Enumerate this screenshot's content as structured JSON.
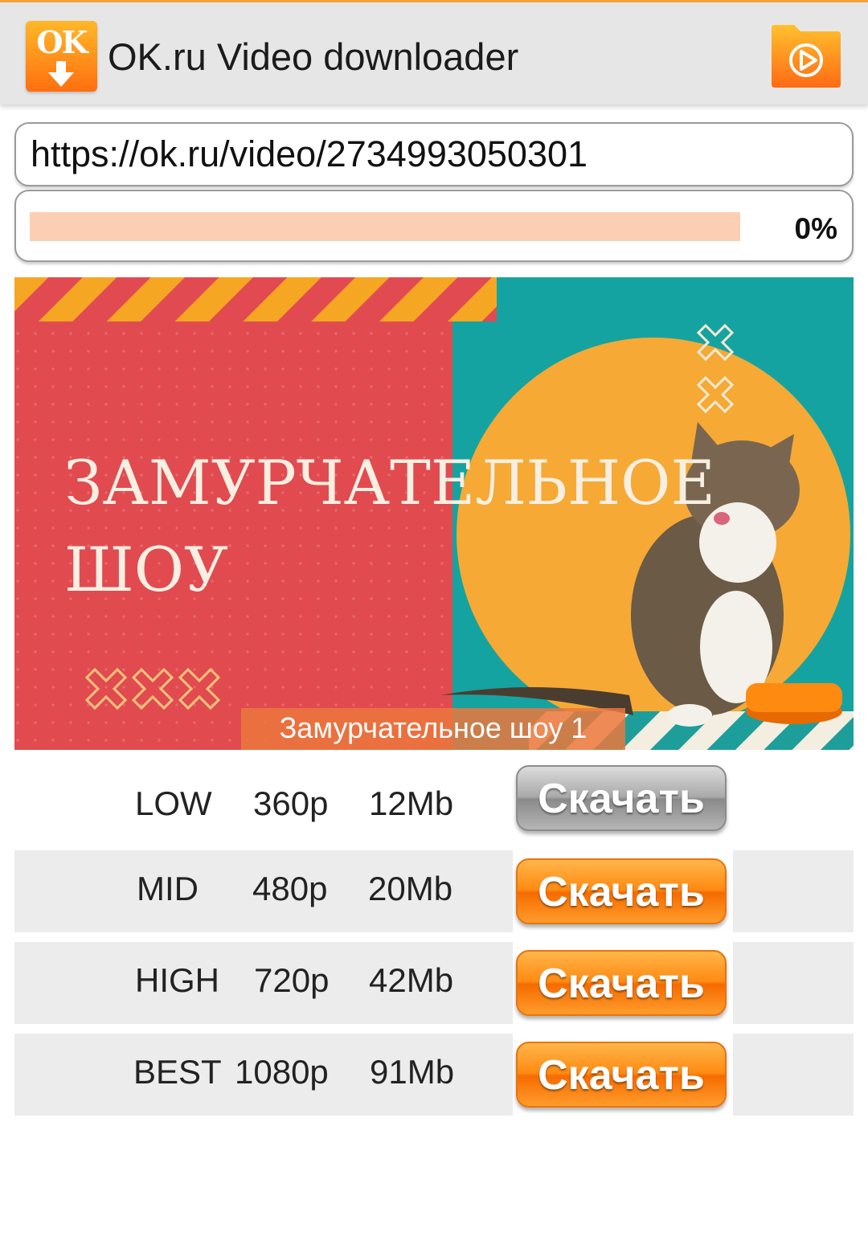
{
  "app": {
    "logo_text": "OK",
    "title": "OK.ru Video downloader"
  },
  "url_input": {
    "value": "https://ok.ru/video/2734993050301"
  },
  "download_progress": {
    "percent": 0,
    "label": "0%"
  },
  "video": {
    "thumbnail_title": "ЗАМУРЧАТЕЛЬНОЕ ШОУ",
    "caption": "Замурчательное шоу 1"
  },
  "qualities": [
    {
      "name": "LOW",
      "resolution": "360p",
      "size": "12Mb",
      "button": "Скачать"
    },
    {
      "name": "MID",
      "resolution": "480p",
      "size": "20Mb",
      "button": "Скачать"
    },
    {
      "name": "HIGH",
      "resolution": "720p",
      "size": "42Mb",
      "button": "Скачать"
    },
    {
      "name": "BEST",
      "resolution": "1080p",
      "size": "91Mb",
      "button": "Скачать"
    }
  ],
  "icons": {
    "logo": "ok-download-logo-icon",
    "folder": "video-folder-icon"
  },
  "colors": {
    "accent": "#ff8a12",
    "progress_track": "#fccfb4",
    "appbar": "#e6e6e6"
  }
}
